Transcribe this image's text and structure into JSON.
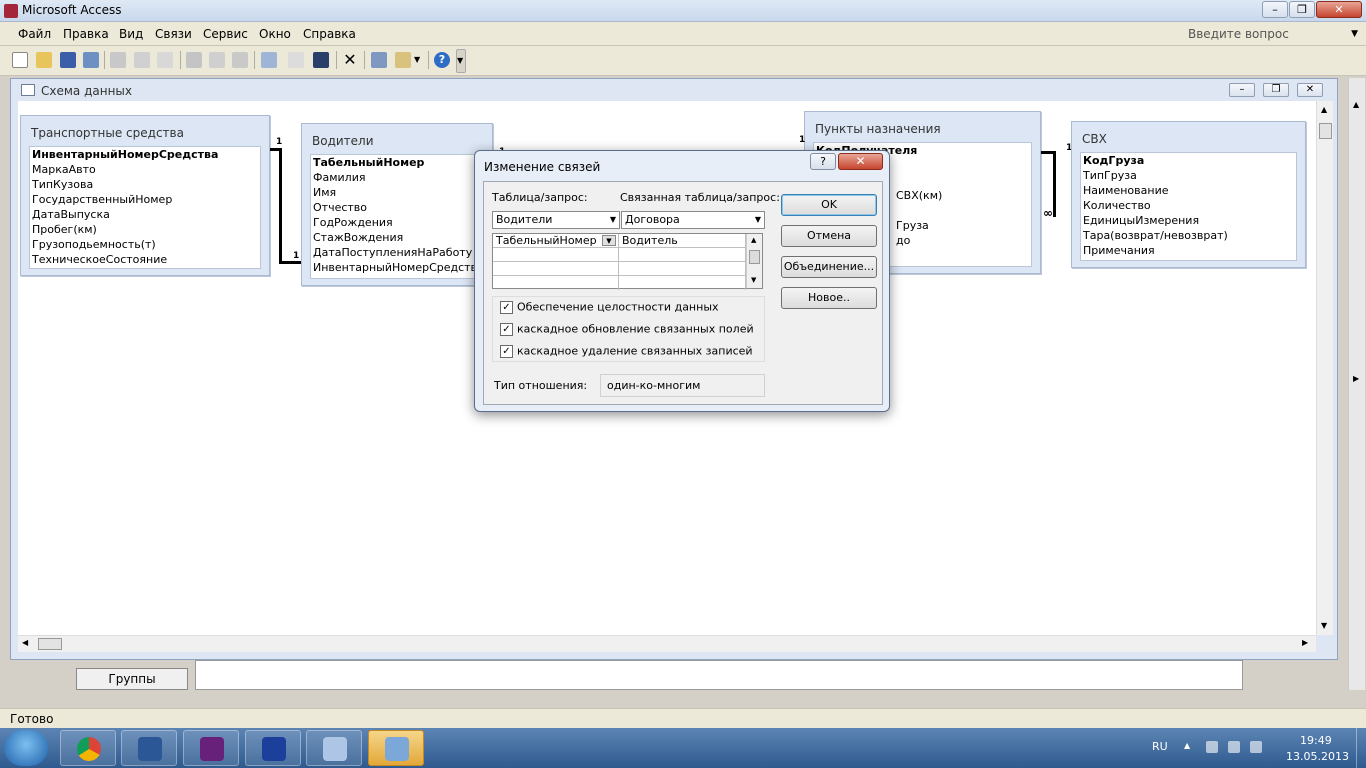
{
  "app": {
    "title": "Microsoft Access"
  },
  "menu": {
    "items": [
      "Файл",
      "Правка",
      "Вид",
      "Связи",
      "Сервис",
      "Окно",
      "Справка"
    ],
    "help_placeholder": "Введите вопрос"
  },
  "mdi": {
    "title": "Схема данных"
  },
  "tables": [
    {
      "title": "Транспортные средства",
      "fields": [
        "ИнвентарныйНомерСредства",
        "МаркаАвто",
        "ТипКузова",
        "ГосударственныйНомер",
        "ДатаВыпуска",
        "Пробег(км)",
        "Грузоподьемность(т)",
        "ТехническоеСостояние"
      ]
    },
    {
      "title": "Водители",
      "fields": [
        "ТабельныйНомер",
        "Фамилия",
        "Имя",
        "Отчество",
        "ГодРождения",
        "СтажВождения",
        "ДатаПоступленияНаРаботу",
        "ИнвентарныйНомерСредства"
      ]
    },
    {
      "title": "Пункты назначения",
      "fields": [
        "КодПолучателя",
        "",
        "",
        "СВХ(км)",
        "",
        "Груза",
        "до"
      ]
    },
    {
      "title": "СВХ",
      "fields": [
        "КодГруза",
        "ТипГруза",
        "Наименование",
        "Количество",
        "ЕдиницыИзмерения",
        "Тара(возврат/невозврат)",
        "Примечания"
      ]
    }
  ],
  "relations": {
    "one": "1",
    "many": "∞"
  },
  "dialog": {
    "title": "Изменение связей",
    "help": "?",
    "close": "✕",
    "table_label": "Таблица/запрос:",
    "related_label": "Связанная таблица/запрос:",
    "table_value": "Водители",
    "related_value": "Договора",
    "grid": [
      [
        "ТабельныйНомер",
        "Водитель"
      ],
      [
        "",
        ""
      ],
      [
        "",
        ""
      ],
      [
        "",
        ""
      ]
    ],
    "checks": [
      {
        "label": "Обеспечение целостности данных",
        "checked": true
      },
      {
        "label": "каскадное обновление связанных полей",
        "checked": true
      },
      {
        "label": "каскадное удаление связанных записей",
        "checked": true
      }
    ],
    "relation_type_label": "Тип отношения:",
    "relation_type_value": "один-ко-многим",
    "buttons": {
      "ok": "OK",
      "cancel": "Отмена",
      "join": "Объединение...",
      "new": "Новое.."
    }
  },
  "groups_tab": "Группы",
  "status": "Готово",
  "tray": {
    "lang": "RU",
    "time": "19:49",
    "date": "13.05.2013"
  }
}
